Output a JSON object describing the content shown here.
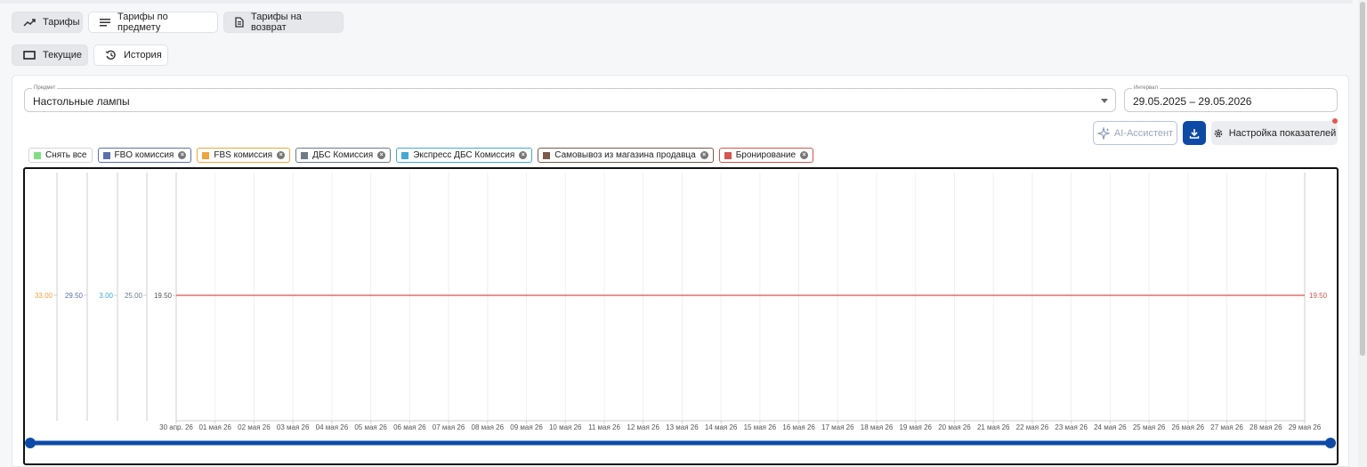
{
  "tabs": [
    {
      "label": "Тарифы",
      "icon": "trend-icon",
      "active": true
    },
    {
      "label": "Тарифы по предмету",
      "icon": "list-icon",
      "active": false
    },
    {
      "label": "Тарифы на возврат",
      "icon": "receipt-icon",
      "active": true
    }
  ],
  "subtabs": [
    {
      "label": "Текущие",
      "icon": "window-icon",
      "active": true
    },
    {
      "label": "История",
      "icon": "history-icon",
      "active": false
    }
  ],
  "filters": {
    "subject_label": "Предмет",
    "subject_value": "Настольные лампы",
    "interval_label": "Интервал",
    "interval_value": "29.05.2025 – 29.05.2026"
  },
  "actions": {
    "ai_label": "AI-Ассистент",
    "settings_label": "Настройка показателей"
  },
  "colors": {
    "accent": "#0d4aa8",
    "fbo": "#5a6fb1",
    "fbs": "#f0a43a",
    "dbs": "#6b7b88",
    "express": "#40a9db",
    "pickup": "#7b5a4a",
    "booking": "#d9534f",
    "select_all": "#7fe07f"
  },
  "chips": [
    {
      "label": "Снять все",
      "color": "#7fe07f",
      "border": "#d5d5d5",
      "removable": false
    },
    {
      "label": "FBO комиссия",
      "color": "#5a6fb1",
      "border": "#5a6fb1",
      "removable": true
    },
    {
      "label": "FBS комиссия",
      "color": "#f0a43a",
      "border": "#f0a43a",
      "removable": true
    },
    {
      "label": "ДБС Комиссия",
      "color": "#6b7b88",
      "border": "#6b7b88",
      "removable": true
    },
    {
      "label": "Экспресс ДБС Комиссия",
      "color": "#40a9db",
      "border": "#40a9db",
      "removable": true
    },
    {
      "label": "Самовывоз из магазина продавца",
      "color": "#7b5a4a",
      "border": "#7b5a4a",
      "removable": true
    },
    {
      "label": "Бронирование",
      "color": "#d9534f",
      "border": "#d9534f",
      "removable": true
    }
  ],
  "chart_data": {
    "type": "line",
    "x": [
      "30 апр. 26",
      "01 мая 26",
      "02 мая 26",
      "03 мая 26",
      "04 мая 26",
      "05 мая 26",
      "06 мая 26",
      "07 мая 26",
      "08 мая 26",
      "09 мая 26",
      "10 мая 26",
      "11 мая 26",
      "12 мая 26",
      "13 мая 26",
      "14 мая 26",
      "15 мая 26",
      "16 мая 26",
      "17 мая 26",
      "18 мая 26",
      "19 мая 26",
      "20 мая 26",
      "21 мая 26",
      "22 мая 26",
      "23 мая 26",
      "24 мая 26",
      "25 мая 26",
      "26 мая 26",
      "27 мая 26",
      "28 мая 26",
      "29 мая 26"
    ],
    "axes": [
      {
        "label": "33.00",
        "color": "#f0a43a"
      },
      {
        "label": "29.50",
        "color": "#5a6fb1"
      },
      {
        "label": "3.00",
        "color": "#40a9db"
      },
      {
        "label": "25.00",
        "color": "#6b7b88"
      },
      {
        "label": "19.50",
        "color": "#555555"
      }
    ],
    "right_axis_label": "19.50",
    "series": [
      {
        "name": "Бронирование",
        "color": "#d9534f",
        "values": [
          19.5,
          19.5,
          19.5,
          19.5,
          19.5,
          19.5,
          19.5,
          19.5,
          19.5,
          19.5,
          19.5,
          19.5,
          19.5,
          19.5,
          19.5,
          19.5,
          19.5,
          19.5,
          19.5,
          19.5,
          19.5,
          19.5,
          19.5,
          19.5,
          19.5,
          19.5,
          19.5,
          19.5,
          19.5,
          19.5
        ]
      }
    ],
    "grid": true,
    "slider_range": [
      0,
      1
    ]
  }
}
